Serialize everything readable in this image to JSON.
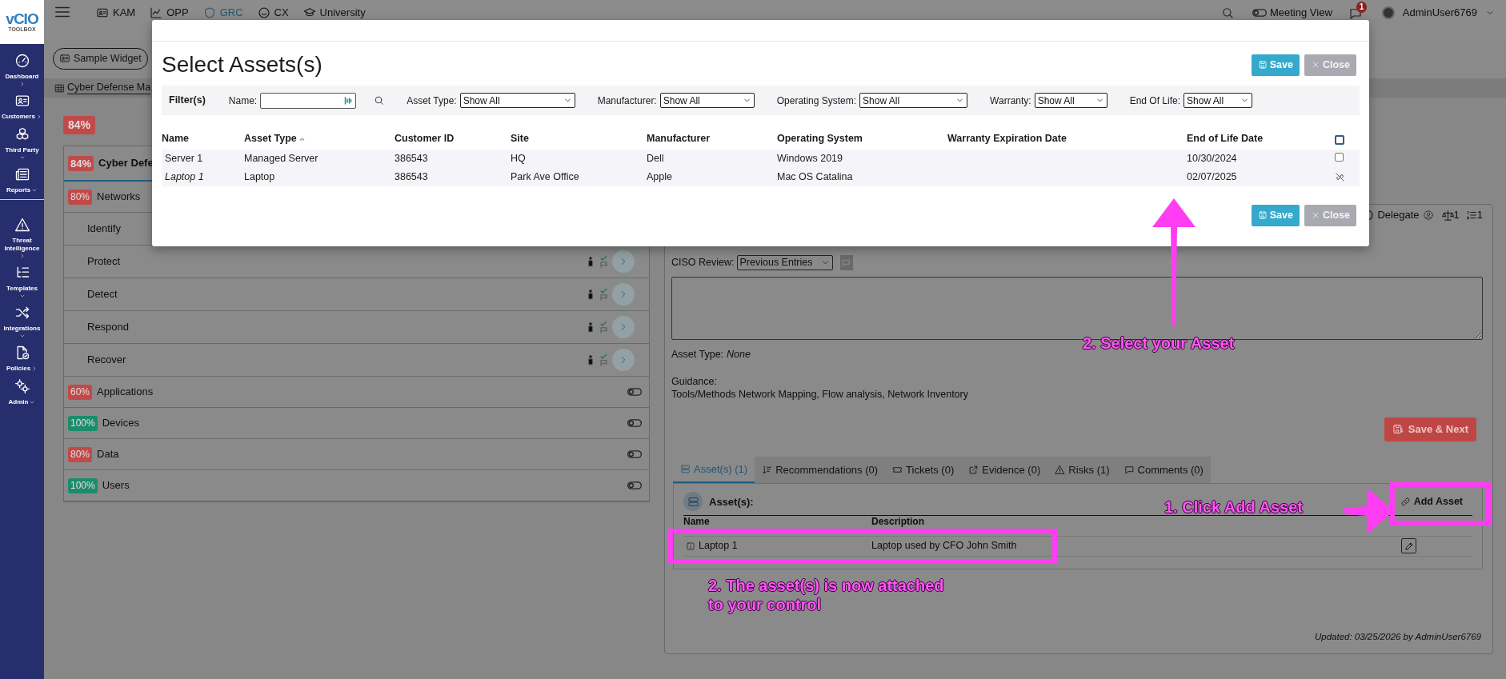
{
  "logo": {
    "text": "vCIO",
    "subtext": "TOOLBOX"
  },
  "sidebar": {
    "groups": [
      [
        {
          "label": "Dashboard",
          "caret_down": false,
          "inline_caret": false
        },
        {
          "label": "Customers",
          "caret_down": false,
          "inline_caret": true
        },
        {
          "label": "Third Party",
          "caret_down": true,
          "inline_caret": false
        },
        {
          "label": "Reports",
          "caret_down": true,
          "inline_caret": true
        }
      ],
      [
        {
          "label": "Threat Intelligence",
          "caret_down": false,
          "inline_caret": false
        },
        {
          "label": "Templates",
          "caret_down": true,
          "inline_caret": false
        },
        {
          "label": "Integrations",
          "caret_down": true,
          "inline_caret": false
        },
        {
          "label": "Policies",
          "caret_down": false,
          "inline_caret": true
        },
        {
          "label": "Admin",
          "caret_down": true,
          "inline_caret": true
        }
      ]
    ]
  },
  "topnav": [
    {
      "label": "KAM",
      "selected": false
    },
    {
      "label": "OPP",
      "selected": false
    },
    {
      "label": "GRC",
      "selected": true
    },
    {
      "label": "CX",
      "selected": false
    },
    {
      "label": "University",
      "selected": false
    }
  ],
  "header_right": {
    "meeting_view": {
      "label": "Meeting View",
      "on": false
    },
    "notification_count": "1",
    "user": "AdminUser6769"
  },
  "toolbar": {
    "widget": "Sample Widget"
  },
  "breadcrumb": "Cyber Defense Ma",
  "overall_score": {
    "text": "84%",
    "color": "#c04a4a"
  },
  "framework": {
    "score": {
      "text": "84%",
      "color": "#c04a4a"
    },
    "title": "Cyber Defe",
    "categories": [
      {
        "label": "Networks",
        "score": "80%",
        "color": "#c04a4a",
        "expanded": true,
        "children": [
          {
            "label": "Identify"
          },
          {
            "label": "Protect",
            "status_icons": true
          },
          {
            "label": "Detect",
            "status_icons": true
          },
          {
            "label": "Respond",
            "status_icons": true
          },
          {
            "label": "Recover",
            "status_icons": true
          }
        ]
      },
      {
        "label": "Applications",
        "score": "60%",
        "color": "#c04a4a",
        "expanded": false,
        "on": false
      },
      {
        "label": "Devices",
        "score": "100%",
        "color": "#1c8c6c",
        "expanded": false,
        "on": false
      },
      {
        "label": "Data",
        "score": "80%",
        "color": "#c04a4a",
        "expanded": false,
        "on": false
      },
      {
        "label": "Users",
        "score": "100%",
        "color": "#1c8c6c",
        "expanded": false,
        "on": false
      }
    ]
  },
  "control_panel": {
    "header": {
      "delegate": "Delegate",
      "approvals": "1",
      "tasks": "1"
    },
    "ciso_review": {
      "label": "CISO Review:",
      "value": "Previous Entries"
    },
    "asset_type": {
      "label": "Asset Type:",
      "value": "None"
    },
    "guidance": {
      "label": "Guidance:",
      "text": "Tools/Methods Network Mapping, Flow analysis, Network Inventory"
    },
    "save_next": "Save & Next",
    "tabs": [
      {
        "label": "Asset(s) (1)",
        "selected": true
      },
      {
        "label": "Recommendations (0)",
        "selected": false
      },
      {
        "label": "Tickets (0)",
        "selected": false
      },
      {
        "label": "Evidence (0)",
        "selected": false
      },
      {
        "label": "Risks (1)",
        "selected": false
      },
      {
        "label": "Comments (0)",
        "selected": false
      }
    ],
    "assets": {
      "title": "Asset(s):",
      "add_button": "Add Asset",
      "columns": [
        "Name",
        "Description"
      ],
      "rows": [
        {
          "name": "Laptop 1",
          "description": "Laptop used by CFO John Smith"
        }
      ]
    },
    "updated": "Updated: 03/25/2026 by AdminUser6769"
  },
  "modal": {
    "title": "Select Assets(s)",
    "header_buttons": [
      {
        "label": "Save",
        "kind": "primary"
      },
      {
        "label": "Close",
        "kind": "secondary"
      }
    ],
    "filters": {
      "label": "Filter(s)",
      "fields": [
        {
          "label": "Name:",
          "kind": "text"
        },
        {
          "label": "Asset Type:",
          "kind": "select",
          "value": "Show All"
        },
        {
          "label": "Manufacturer:",
          "kind": "select",
          "value": "Show All"
        },
        {
          "label": "Operating System:",
          "kind": "select",
          "value": "Show All"
        },
        {
          "label": "Warranty:",
          "kind": "select",
          "value": "Show All"
        },
        {
          "label": "End Of Life:",
          "kind": "select",
          "value": "Show All"
        }
      ]
    },
    "table": {
      "columns": [
        {
          "label": "Name",
          "sorted": false
        },
        {
          "label": "Asset Type",
          "sorted": true
        },
        {
          "label": "Customer ID",
          "sorted": false
        },
        {
          "label": "Site",
          "sorted": false
        },
        {
          "label": "Manufacturer",
          "sorted": false
        },
        {
          "label": "Operating System",
          "sorted": false
        },
        {
          "label": "Warranty Expiration Date",
          "sorted": false
        },
        {
          "label": "End of Life Date",
          "sorted": false
        }
      ],
      "select_all": {
        "checked": false
      },
      "rows": [
        {
          "name": "Server 1",
          "asset_type": "Managed Server",
          "customer_id": "386543",
          "site": "HQ",
          "manufacturer": "Dell",
          "operating_system": "Windows 2019",
          "end_of_life_date": "10/30/2024",
          "attached": false,
          "checked": false
        },
        {
          "name": "Laptop 1",
          "asset_type": "Laptop",
          "customer_id": "386543",
          "site": "Park Ave Office",
          "manufacturer": "Apple",
          "operating_system": "Mac OS Catalina",
          "end_of_life_date": "02/07/2025",
          "attached": true
        }
      ]
    },
    "footer_buttons": [
      {
        "label": "Save",
        "kind": "primary"
      },
      {
        "label": "Close",
        "kind": "secondary"
      }
    ]
  },
  "annotations": [
    {
      "kind": "arrow_up"
    },
    {
      "kind": "label",
      "text": "2. Select your Asset"
    },
    {
      "kind": "label",
      "text": "1. Click Add Asset"
    },
    {
      "kind": "arrow_right"
    },
    {
      "kind": "highlight"
    },
    {
      "kind": "highlight"
    },
    {
      "kind": "label",
      "text": "2. The asset(s) is now attached to your control"
    }
  ]
}
